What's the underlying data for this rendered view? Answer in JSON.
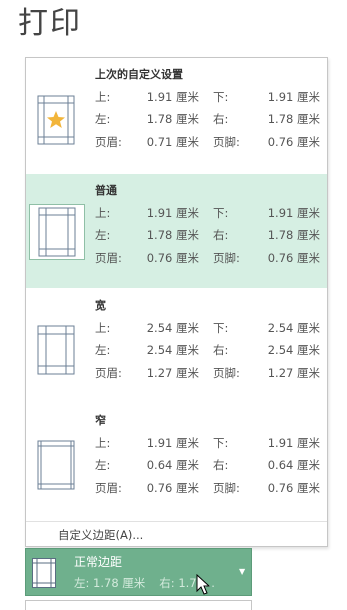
{
  "page_title": "打印",
  "colors": {
    "selected_bg": "#d6efe3",
    "dropdown_bg": "#6fb08d",
    "accent": "#4e9a6f"
  },
  "presets": [
    {
      "name": "上次的自定义设置",
      "icon": "star-page-icon",
      "rows": [
        {
          "l1": "上:",
          "v1": "1.91 厘米",
          "l2": "下:",
          "v2": "1.91 厘米"
        },
        {
          "l1": "左:",
          "v1": "1.78 厘米",
          "l2": "右:",
          "v2": "1.78 厘米"
        },
        {
          "l1": "页眉:",
          "v1": "0.71 厘米",
          "l2": "页脚:",
          "v2": "0.76 厘米"
        }
      ]
    },
    {
      "name": "普通",
      "selected": true,
      "icon": "normal-margins-icon",
      "rows": [
        {
          "l1": "上:",
          "v1": "1.91 厘米",
          "l2": "下:",
          "v2": "1.91 厘米"
        },
        {
          "l1": "左:",
          "v1": "1.78 厘米",
          "l2": "右:",
          "v2": "1.78 厘米"
        },
        {
          "l1": "页眉:",
          "v1": "0.76 厘米",
          "l2": "页脚:",
          "v2": "0.76 厘米"
        }
      ]
    },
    {
      "name": "宽",
      "icon": "wide-margins-icon",
      "rows": [
        {
          "l1": "上:",
          "v1": "2.54 厘米",
          "l2": "下:",
          "v2": "2.54 厘米"
        },
        {
          "l1": "左:",
          "v1": "2.54 厘米",
          "l2": "右:",
          "v2": "2.54 厘米"
        },
        {
          "l1": "页眉:",
          "v1": "1.27 厘米",
          "l2": "页脚:",
          "v2": "1.27 厘米"
        }
      ]
    },
    {
      "name": "窄",
      "icon": "narrow-margins-icon",
      "rows": [
        {
          "l1": "上:",
          "v1": "1.91 厘米",
          "l2": "下:",
          "v2": "1.91 厘米"
        },
        {
          "l1": "左:",
          "v1": "0.64 厘米",
          "l2": "右:",
          "v2": "0.64 厘米"
        },
        {
          "l1": "页眉:",
          "v1": "0.76 厘米",
          "l2": "页脚:",
          "v2": "0.76 厘米"
        }
      ]
    }
  ],
  "custom_margins_label": "自定义边距(A)...",
  "dropdown": {
    "title": "正常边距",
    "sub_left": "左: 1.78 厘米",
    "sub_right": "右: 1.78..."
  }
}
